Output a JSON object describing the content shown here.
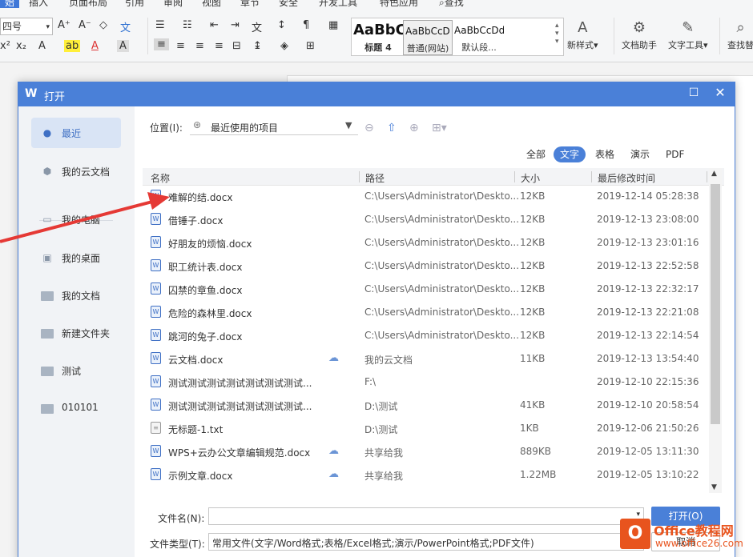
{
  "menubar": {
    "items": [
      "始",
      "插入",
      "页面布局",
      "引用",
      "审阅",
      "视图",
      "章节",
      "安全",
      "开发工具",
      "特色应用",
      "查找"
    ]
  },
  "ribbon": {
    "font_size": "四号",
    "styles": [
      {
        "preview": "AaBbC",
        "label": "标题 4"
      },
      {
        "preview": "AaBbCcD",
        "label": "普通(网站)"
      },
      {
        "preview": "AaBbCcDd",
        "label": "默认段..."
      }
    ],
    "new_style": "新样式",
    "doc_helper": "文档助手",
    "text_tools": "文字工具",
    "find_replace": "查找替"
  },
  "dialog": {
    "title": "打开",
    "sidebar": [
      {
        "label": "最近",
        "icon": "clock-icon"
      },
      {
        "label": "我的云文档",
        "icon": "cloud-doc-icon"
      },
      {
        "label": "我的电脑",
        "icon": "computer-icon"
      },
      {
        "label": "我的桌面",
        "icon": "desktop-icon"
      },
      {
        "label": "我的文档",
        "icon": "folder-icon"
      },
      {
        "label": "新建文件夹",
        "icon": "folder-icon"
      },
      {
        "label": "测试",
        "icon": "folder-icon"
      },
      {
        "label": "010101",
        "icon": "folder-icon"
      }
    ],
    "location_label": "位置(I):",
    "location_value": "最近使用的项目",
    "filter_tabs": [
      "全部",
      "文字",
      "表格",
      "演示",
      "PDF"
    ],
    "active_filter": "文字",
    "columns": [
      "名称",
      "路径",
      "大小",
      "最后修改时间"
    ],
    "files": [
      {
        "name": "难解的结.docx",
        "path": "C:\\Users\\Administrator\\Deskto...",
        "size": "12KB",
        "date": "2019-12-14 05:28:38",
        "type": "doc",
        "cloud": false
      },
      {
        "name": "借锤子.docx",
        "path": "C:\\Users\\Administrator\\Deskto...",
        "size": "12KB",
        "date": "2019-12-13 23:08:00",
        "type": "doc",
        "cloud": false
      },
      {
        "name": "好朋友的烦恼.docx",
        "path": "C:\\Users\\Administrator\\Deskto...",
        "size": "12KB",
        "date": "2019-12-13 23:01:16",
        "type": "doc",
        "cloud": false
      },
      {
        "name": "职工统计表.docx",
        "path": "C:\\Users\\Administrator\\Deskto...",
        "size": "12KB",
        "date": "2019-12-13 22:52:58",
        "type": "doc",
        "cloud": false
      },
      {
        "name": "囚禁的章鱼.docx",
        "path": "C:\\Users\\Administrator\\Deskto...",
        "size": "12KB",
        "date": "2019-12-13 22:32:17",
        "type": "doc",
        "cloud": false
      },
      {
        "name": "危险的森林里.docx",
        "path": "C:\\Users\\Administrator\\Deskto...",
        "size": "12KB",
        "date": "2019-12-13 22:21:08",
        "type": "doc",
        "cloud": false
      },
      {
        "name": "跳河的兔子.docx",
        "path": "C:\\Users\\Administrator\\Deskto...",
        "size": "12KB",
        "date": "2019-12-13 22:14:54",
        "type": "doc",
        "cloud": false
      },
      {
        "name": "云文档.docx",
        "path": "我的云文档",
        "size": "11KB",
        "date": "2019-12-13 13:54:40",
        "type": "doc",
        "cloud": true
      },
      {
        "name": "测试测试测试测试测试测试测试...",
        "path": "F:\\",
        "size": "",
        "date": "2019-12-10 22:15:36",
        "type": "doc",
        "cloud": false
      },
      {
        "name": "测试测试测试测试测试测试测试...",
        "path": "D:\\测试",
        "size": "41KB",
        "date": "2019-12-10 20:58:54",
        "type": "doc",
        "cloud": false
      },
      {
        "name": "无标题-1.txt",
        "path": "D:\\测试",
        "size": "1KB",
        "date": "2019-12-06 21:50:26",
        "type": "txt",
        "cloud": false
      },
      {
        "name": "WPS+云办公文章编辑规范.docx",
        "path": "共享给我",
        "size": "889KB",
        "date": "2019-12-05 13:11:30",
        "type": "doc",
        "cloud": true
      },
      {
        "name": "示例文章.docx",
        "path": "共享给我",
        "size": "1.22MB",
        "date": "2019-12-05 13:10:22",
        "type": "doc",
        "cloud": true
      }
    ],
    "filename_label": "文件名(N):",
    "filename_value": "",
    "filetype_label": "文件类型(T):",
    "filetype_value": "常用文件(文字/Word格式;表格/Excel格式;演示/PowerPoint格式;PDF文件)",
    "open_button": "打开(O)",
    "cancel_button": "取消"
  },
  "watermark": {
    "brand": "Office教程网",
    "url": "www.office26.com"
  },
  "colors": {
    "accent": "#4a80d8",
    "arrow": "#e53935",
    "watermark": "#e8541e"
  }
}
